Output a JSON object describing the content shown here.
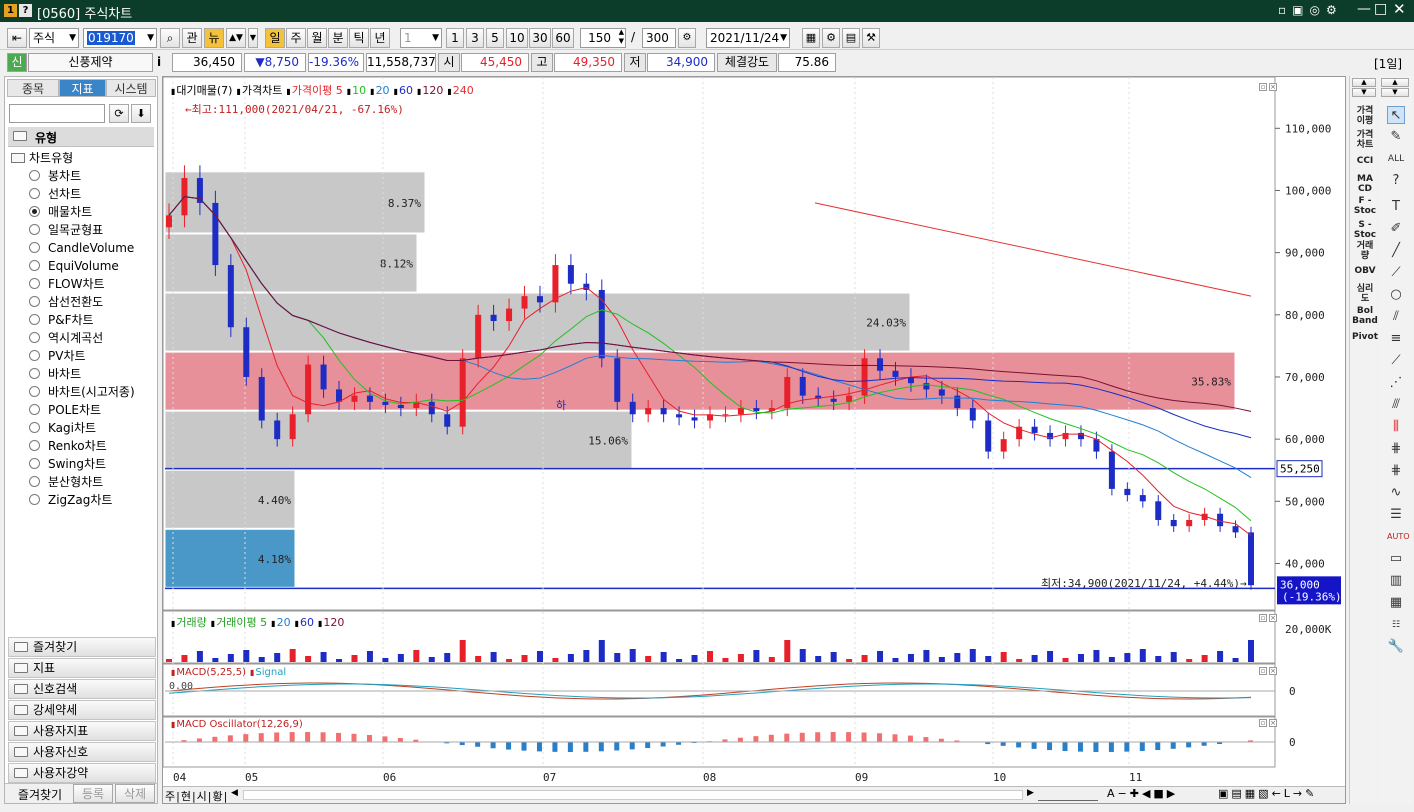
{
  "window": {
    "badge1": "1",
    "badge2": "?",
    "title": "[0560] 주식차트"
  },
  "toolbar": {
    "market": "주식",
    "code": "019170",
    "btn_gwan": "관",
    "btn_nyu": "뉴",
    "periods": [
      "일",
      "주",
      "월",
      "분",
      "틱",
      "년"
    ],
    "period_count": "1",
    "intervals": [
      "1",
      "3",
      "5",
      "10",
      "30",
      "60"
    ],
    "count": "150",
    "total": "300",
    "date": "2021/11/24"
  },
  "quote": {
    "badge": "신",
    "name": "신풍제약",
    "info": "i",
    "price": "36,450",
    "change": "▼8,750",
    "pct": "-19.36%",
    "volume": "11,558,737",
    "open_label": "시",
    "open": "45,450",
    "high_label": "고",
    "high": "49,350",
    "low_label": "저",
    "low": "34,900",
    "strength_label": "체결강도",
    "strength": "75.86",
    "period_badge": "[1일]"
  },
  "left_panel": {
    "tabs": [
      "종목",
      "지표",
      "시스템"
    ],
    "section": "유형",
    "tree_root": "차트유형",
    "chart_types": [
      "봉차트",
      "선차트",
      "매물차트",
      "일목균형표",
      "CandleVolume",
      "EquiVolume",
      "FLOW차트",
      "삼선전환도",
      "P&F차트",
      "역시계곡선",
      "PV차트",
      "바차트",
      "바차트(시고저종)",
      "POLE차트",
      "Kagi차트",
      "Renko차트",
      "Swing차트",
      "분산형차트",
      "ZigZag차트"
    ],
    "selected": "매물차트",
    "accordion": [
      "즐겨찾기",
      "지표",
      "신호검색",
      "강세약세",
      "사용자지표",
      "사용자신호",
      "사용자강약"
    ],
    "bottom_tabs": [
      "즐겨찾기",
      "등록",
      "삭제"
    ]
  },
  "legend_price": {
    "items": [
      "대기매물(7)",
      "가격차트",
      "가격이평 5",
      "10",
      "20",
      "60",
      "120",
      "240"
    ]
  },
  "legend_volume": {
    "items": [
      "거래량",
      "거래이평 5",
      "20",
      "60",
      "120"
    ]
  },
  "legend_macd": {
    "items": [
      "MACD(5,25,5)",
      "Signal"
    ]
  },
  "legend_osc": {
    "items": [
      "MACD Oscillator(12,26,9)"
    ]
  },
  "annotations": {
    "high": "←최고:111,000(2021/04/21, -67.16%)",
    "low": "최저:34,900(2021/11/24, +4.44%)→",
    "ha": "하",
    "line_label": "55,250",
    "cur_price": "36,000",
    "cur_pct": "(-19.36%)",
    "macd_zero": "0.00"
  },
  "chart_data": {
    "type": "candlestick",
    "x_ticks": [
      "04",
      "05",
      "06",
      "07",
      "08",
      "09",
      "10",
      "11"
    ],
    "y_ticks": [
      "110,000",
      "100,000",
      "90,000",
      "80,000",
      "70,000",
      "60,000",
      "50,000",
      "40,000"
    ],
    "volume_tick": "20,000K",
    "macd_tick": "0",
    "osc_tick": "0",
    "ylim": [
      33000,
      116000
    ],
    "volume_profile": [
      {
        "low": 93000,
        "high": 103000,
        "pct": "8.37%"
      },
      {
        "low": 83500,
        "high": 93000,
        "pct": "8.12%"
      },
      {
        "low": 74000,
        "high": 83500,
        "pct": "24.03%"
      },
      {
        "low": 64500,
        "high": 74000,
        "pct": "35.83%",
        "highlight": true
      },
      {
        "low": 55000,
        "high": 64500,
        "pct": "15.06%"
      },
      {
        "low": 45500,
        "high": 55000,
        "pct": "4.40%"
      },
      {
        "low": 36000,
        "high": 45500,
        "pct": "4.18%",
        "current": true
      }
    ],
    "ma_240": [
      [
        98000,
        0
      ],
      [
        83000,
        1
      ]
    ],
    "candles_close_path": [
      96000,
      102000,
      98000,
      88000,
      78000,
      70000,
      63000,
      60000,
      64000,
      72000,
      68000,
      66000,
      67000,
      66000,
      65500,
      65000,
      66000,
      64000,
      62000,
      73000,
      80000,
      79000,
      81000,
      83000,
      82000,
      88000,
      85000,
      84000,
      73000,
      66000,
      64000,
      65000,
      64000,
      63500,
      63000,
      64000,
      64000,
      65000,
      64500,
      65000,
      70000,
      67000,
      66500,
      66000,
      67000,
      73000,
      71000,
      70000,
      69000,
      68000,
      67000,
      65000,
      63000,
      58000,
      60000,
      62000,
      61000,
      60000,
      61000,
      60000,
      58000,
      52000,
      51000,
      50000,
      47000,
      46000,
      47000,
      48000,
      46000,
      45000,
      36500
    ],
    "colors": {
      "up": "#e8202a",
      "down": "#1c2cc4",
      "ma5": "#e8202a",
      "ma10": "#22c022",
      "ma20": "#1f7fd8",
      "ma60": "#1c2cc4",
      "ma120": "#7a1030",
      "ma240": "#e83030",
      "profile": "#c8c8c8",
      "profile_hi": "#e8909a",
      "profile_cur": "#4a98c8"
    }
  }
}
